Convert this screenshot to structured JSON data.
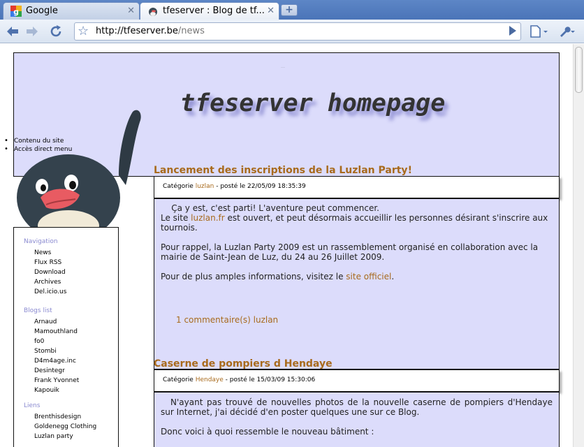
{
  "browser": {
    "tabs": [
      {
        "label": "Google",
        "active": false
      },
      {
        "label": "tfeserver : Blog de tf...",
        "active": true
      }
    ],
    "url_host": "http://tfeserver.be",
    "url_path": "/news"
  },
  "page": {
    "title": "tfeserver homepage",
    "tiny_mark": "......",
    "skip_links": [
      "Contenu du site",
      "Accès direct menu"
    ]
  },
  "sidebar": {
    "navigation_title": "Navigation",
    "navigation": [
      "News",
      "Flux RSS",
      "Download",
      "Archives",
      "Del.icio.us"
    ],
    "blogs_title": "Blogs list",
    "blogs": [
      "Arnaud",
      "Mamouthland",
      "fo0",
      "Stombi",
      "D4m4age.inc",
      "Desintegr",
      "Frank Yvonnet",
      "Kapouik"
    ],
    "links_title": "Liens",
    "links": [
      "Brenthisdesign",
      "Goldenegg Clothing",
      "Luzlan party"
    ]
  },
  "articles": [
    {
      "title": "Lancement des inscriptions de la Luzlan Party!",
      "meta_prefix": "Catégorie ",
      "category": "luzlan",
      "meta_suffix": " - posté le 22/05/09 18:35:39",
      "p1": "    Ça y est, c'est parti! L'aventure peut commencer.",
      "p2_pre": "Le site ",
      "p2_link": "luzlan.fr",
      "p2_post": " est ouvert, et peut désormais accueillir les personnes désirant s'inscrire aux tournois.",
      "p3": "Pour rappel, la Luzlan Party 2009 est un rassemblement organisé en collaboration avec la mairie de Saint-Jean de Luz, du 24 au 26 Juillet 2009.",
      "p4_pre": "Pour de plus amples informations, visitez le ",
      "p4_link": "site officiel",
      "p4_post": ".",
      "comments": "1 commentaire(s) luzlan"
    },
    {
      "title": "Caserne de pompiers d Hendaye",
      "meta_prefix": "Catégorie ",
      "category": "Hendaye",
      "meta_suffix": " - posté le 15/03/09 15:30:06",
      "p1": "N'ayant pas trouvé de nouvelles photos de la nouvelle caserne de pompiers d'Hendaye sur Internet, j'ai décidé d'en poster quelques une sur ce Blog.",
      "p2": "Donc voici à quoi ressemble le nouveau bâtiment :"
    }
  ]
}
